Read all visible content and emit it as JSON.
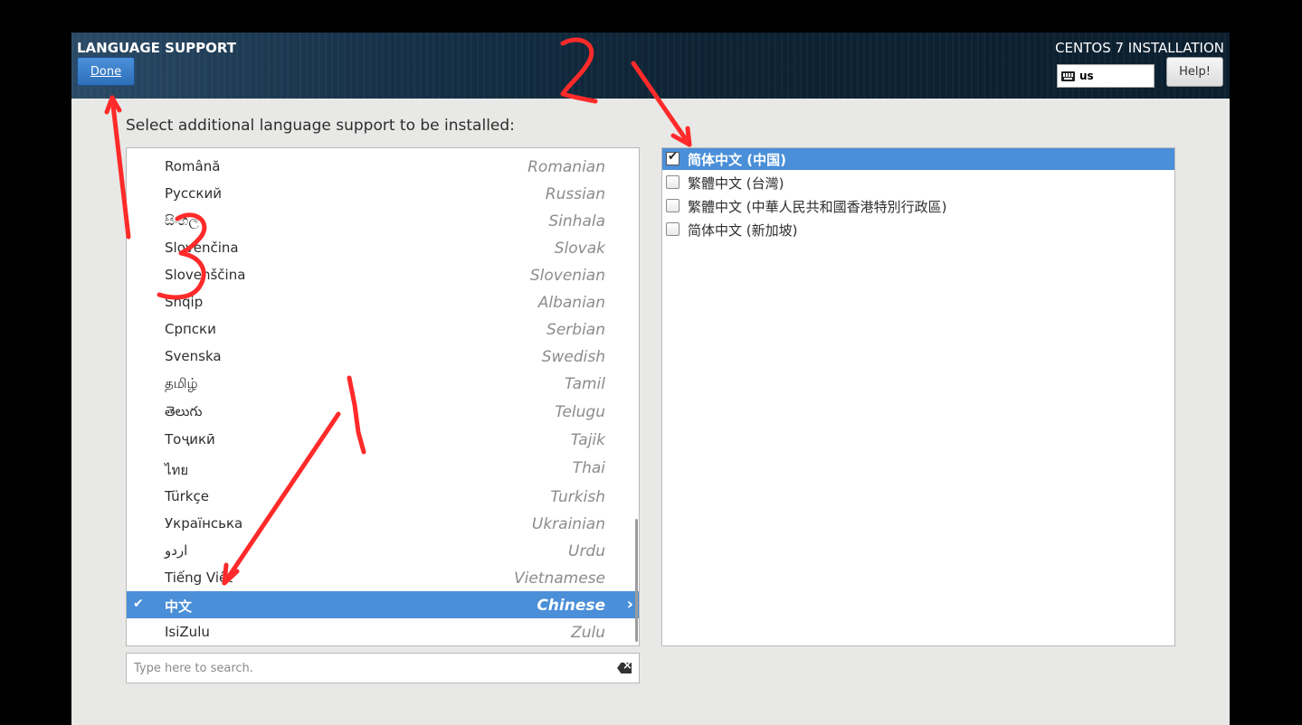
{
  "header": {
    "spoke_title": "LANGUAGE SUPPORT",
    "done_label": "Done",
    "install_title": "CENTOS 7 INSTALLATION",
    "keyboard_layout": "us",
    "help_label": "Help!"
  },
  "prompt": "Select additional language support to be installed:",
  "languages": [
    {
      "native": "Română",
      "english": "Romanian"
    },
    {
      "native": "Русский",
      "english": "Russian"
    },
    {
      "native": "සිංහල",
      "english": "Sinhala"
    },
    {
      "native": "Slovenčina",
      "english": "Slovak"
    },
    {
      "native": "Slovenščina",
      "english": "Slovenian"
    },
    {
      "native": "Shqip",
      "english": "Albanian"
    },
    {
      "native": "Српски",
      "english": "Serbian"
    },
    {
      "native": "Svenska",
      "english": "Swedish"
    },
    {
      "native": "தமிழ்",
      "english": "Tamil"
    },
    {
      "native": "తెలుగు",
      "english": "Telugu"
    },
    {
      "native": "Тоҷикӣ",
      "english": "Tajik"
    },
    {
      "native": "ไทย",
      "english": "Thai"
    },
    {
      "native": "Türkçe",
      "english": "Turkish"
    },
    {
      "native": "Українська",
      "english": "Ukrainian"
    },
    {
      "native": "اردو",
      "english": "Urdu"
    },
    {
      "native": "Tiếng Việt",
      "english": "Vietnamese"
    },
    {
      "native": "中文",
      "english": "Chinese",
      "selected": true
    },
    {
      "native": "IsiZulu",
      "english": "Zulu"
    }
  ],
  "search": {
    "placeholder": "Type here to search."
  },
  "locales": [
    {
      "label": "简体中文 (中国)",
      "checked": true,
      "selected": true
    },
    {
      "label": "繁體中文 (台灣)",
      "checked": false
    },
    {
      "label": "繁體中文 (中華人民共和國香港特別行政區)",
      "checked": false
    },
    {
      "label": "简体中文 (新加坡)",
      "checked": false
    }
  ],
  "annotations": {
    "marks": [
      "1",
      "2",
      "3"
    ],
    "color": "#ff2a2a"
  },
  "colors": {
    "selection": "#4a8fd8",
    "done_button": "#3a80cc"
  }
}
